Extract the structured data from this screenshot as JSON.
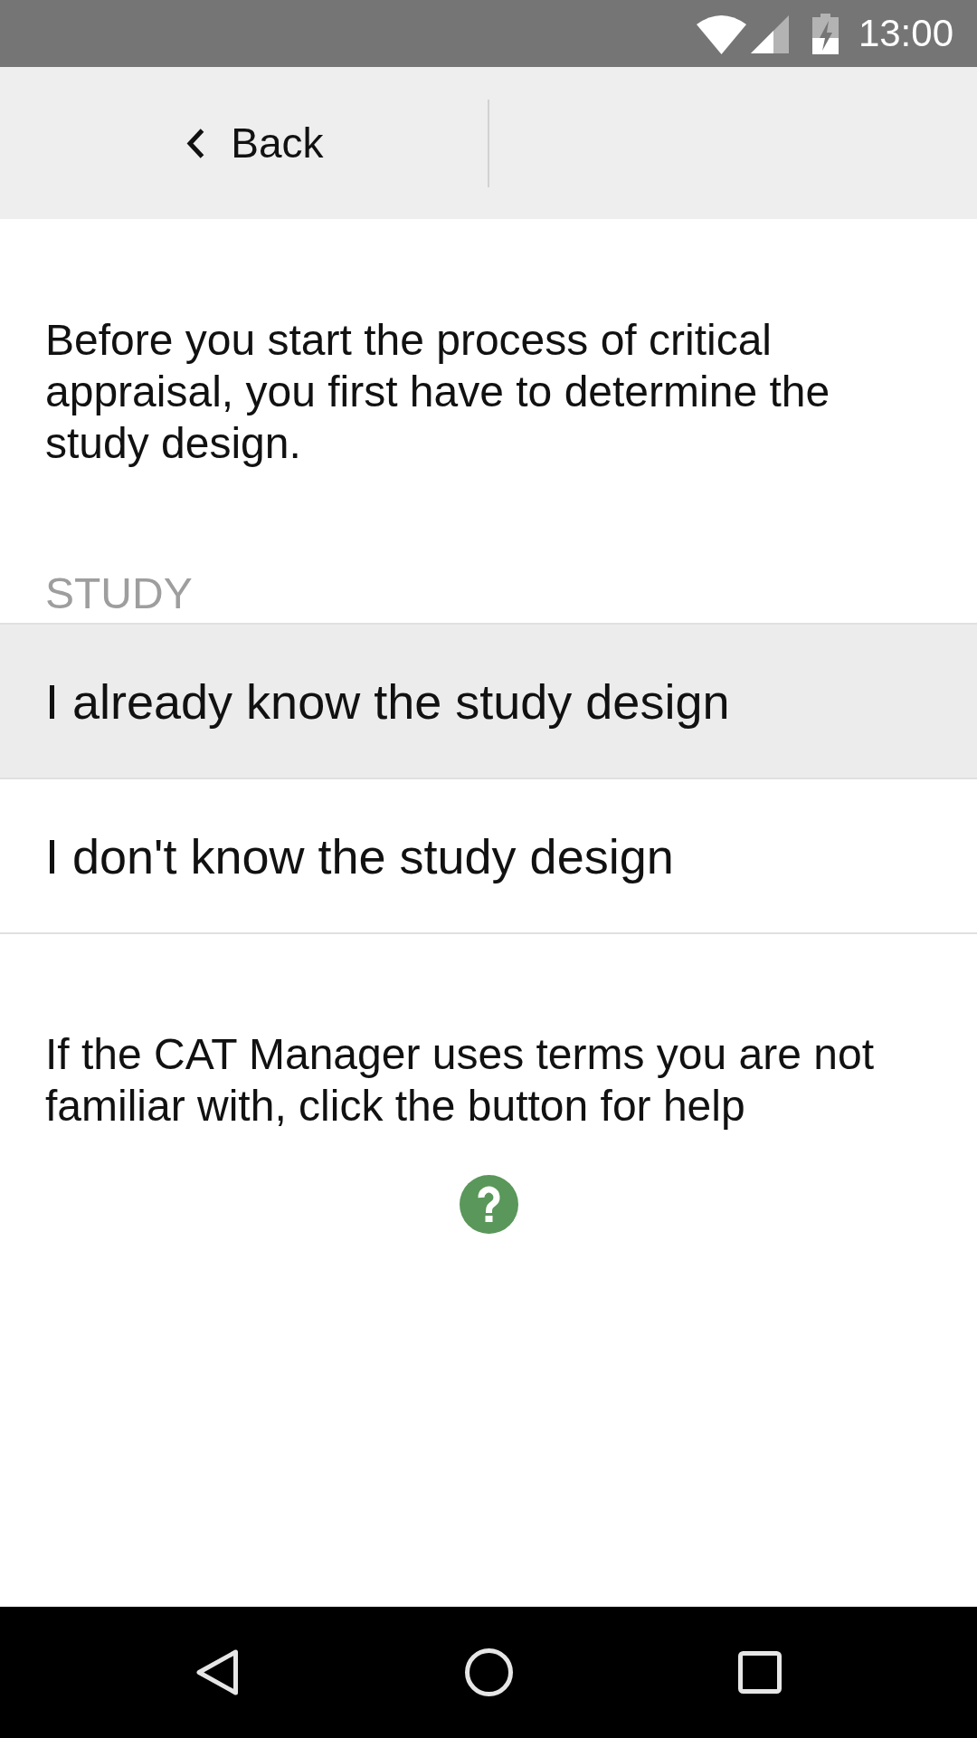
{
  "status_bar": {
    "time": "13:00"
  },
  "header": {
    "back_label": "Back"
  },
  "intro": "Before you start the process of critical appraisal, you first have to determine the study design.",
  "section": {
    "label": "STUDY",
    "options": [
      {
        "label": "I already know the study design",
        "selected": true
      },
      {
        "label": "I don't know the study design",
        "selected": false
      }
    ]
  },
  "help": {
    "text": "If the CAT Manager uses terms you are not familiar with, click the button for help"
  }
}
